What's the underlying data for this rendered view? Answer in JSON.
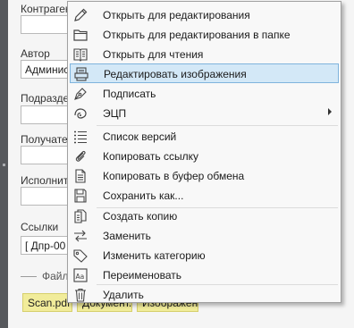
{
  "form": {
    "fields": [
      {
        "label": "Контрагент",
        "value": ""
      },
      {
        "label": "Автор",
        "value": "Администратор"
      },
      {
        "label": "Подразделение",
        "value": ""
      },
      {
        "label": "Получатель",
        "value": ""
      },
      {
        "label": "Исполнитель",
        "value": ""
      },
      {
        "label": "Ссылки",
        "value": "[ Дпр-00"
      }
    ],
    "files_label": "Файлы",
    "files": [
      "Scan.pdf",
      "Документ.pdf",
      "Изображение.jpg"
    ]
  },
  "context_menu": {
    "items": [
      {
        "label": "Открыть для редактирования",
        "icon": "pencil-icon"
      },
      {
        "label": "Открыть для редактирования в папке",
        "icon": "folder-icon"
      },
      {
        "label": "Открыть для чтения",
        "icon": "open-book-icon"
      },
      {
        "label": "Редактировать изображения",
        "icon": "image-edit-icon",
        "highlighted": true
      },
      {
        "label": "Подписать",
        "icon": "pen-nib-icon"
      },
      {
        "label": "ЭЦП",
        "icon": "signature-seal-icon",
        "submenu": true
      },
      {
        "label": "Список версий",
        "icon": "version-list-icon"
      },
      {
        "label": "Копировать ссылку",
        "icon": "paperclip-icon"
      },
      {
        "label": "Копировать в буфер обмена",
        "icon": "document-icon"
      },
      {
        "label": "Сохранить как...",
        "icon": "save-icon"
      },
      {
        "label": "Создать копию",
        "icon": "copy-document-icon"
      },
      {
        "label": "Заменить",
        "icon": "replace-arrows-icon"
      },
      {
        "label": "Изменить категорию",
        "icon": "tag-icon"
      },
      {
        "label": "Переименовать",
        "icon": "rename-icon"
      },
      {
        "label": "Удалить",
        "icon": "trash-icon"
      }
    ]
  },
  "colors": {
    "highlight_bg": "#d3e8f7",
    "highlight_border": "#7fb4dd",
    "file_chip": "#f1ec9a"
  }
}
